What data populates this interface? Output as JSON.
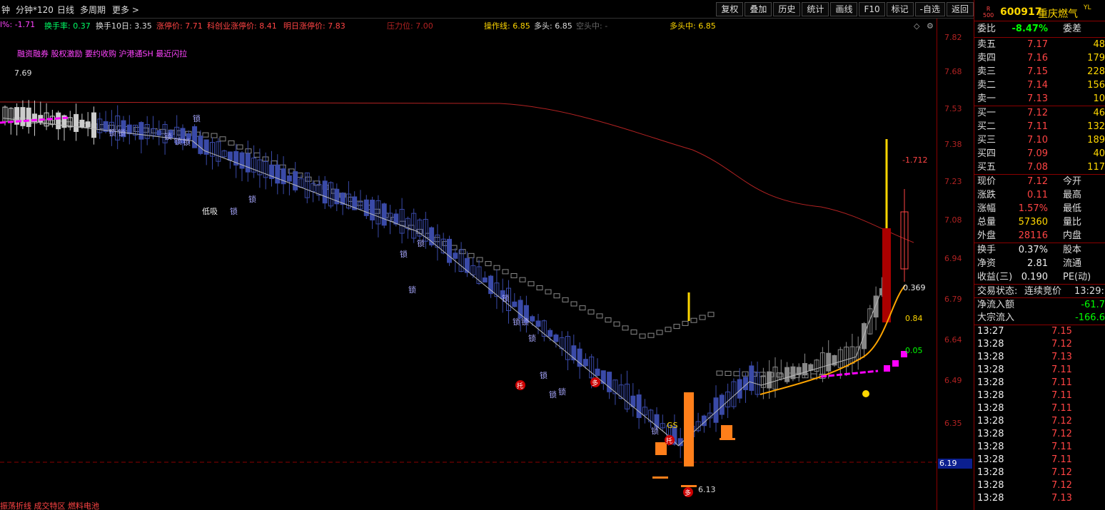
{
  "toolbar": {
    "left": [
      "钟",
      "分钟*120",
      "日线",
      "多周期",
      "更多 >"
    ],
    "right": [
      "复权",
      "叠加",
      "历史",
      "统计",
      "画线",
      "F10",
      "标记",
      "-自选",
      "返回"
    ]
  },
  "indicators": {
    "pct": "l%: -1.71",
    "turnover": "换手率: 0.37",
    "turnover10": "换手10日: 3.35",
    "limit_up": "涨停价: 7.71",
    "star_limit": "科创业涨停价: 8.41",
    "tomorrow_limit": "明日涨停价: 7.83",
    "pressure": "压力位: 7.00",
    "operate_line": "操作线: 6.85",
    "bull": "多头: 6.85",
    "bear": "空头中: -",
    "bull_mid": "多头中: 6.85"
  },
  "tags": "融资融券 股权激励 要约收购 沪港通SH 最近闪拉",
  "chart_labels": {
    "high_label": "7.69",
    "low_label": "6.13",
    "right_v1": "-1.712",
    "right_v2": "0.369",
    "right_v3": "0.84",
    "right_v4": "0.05",
    "low_absorb": "低吸",
    "gs": "GS",
    "lock": "锁",
    "tuo": "托",
    "duo": "多",
    "bottom_text": "振荡折线 成交特区 燃料电池"
  },
  "yaxis": [
    "7.82",
    "7.68",
    "7.53",
    "7.38",
    "7.23",
    "7.08",
    "6.94",
    "6.79",
    "6.64",
    "6.49",
    "6.35",
    "6.19"
  ],
  "current_price_tag": "6.19",
  "colors": {
    "up": "#ff4444",
    "down": "#3a4aa8",
    "orange": "#ff7f1a",
    "ma_white": "#bbbbbb",
    "ma_red": "#b22222",
    "magenta": "#ff00ff",
    "yellow": "#ffd700"
  },
  "quote": {
    "market": "R\n500",
    "code": "600917",
    "name": "重庆燃气",
    "badge": "YL",
    "weibi_label": "委比",
    "weibi": "-8.47%",
    "weicha_label": "委差",
    "asks": [
      {
        "label": "卖五",
        "price": "7.17",
        "vol": "48"
      },
      {
        "label": "卖四",
        "price": "7.16",
        "vol": "179"
      },
      {
        "label": "卖三",
        "price": "7.15",
        "vol": "228"
      },
      {
        "label": "卖二",
        "price": "7.14",
        "vol": "156"
      },
      {
        "label": "卖一",
        "price": "7.13",
        "vol": "10"
      }
    ],
    "bids": [
      {
        "label": "买一",
        "price": "7.12",
        "vol": "46"
      },
      {
        "label": "买二",
        "price": "7.11",
        "vol": "132"
      },
      {
        "label": "买三",
        "price": "7.10",
        "vol": "189"
      },
      {
        "label": "买四",
        "price": "7.09",
        "vol": "40"
      },
      {
        "label": "买五",
        "price": "7.08",
        "vol": "117"
      }
    ],
    "stats": [
      {
        "l": "现价",
        "v": "7.12",
        "cls": "red",
        "r": "今开"
      },
      {
        "l": "涨跌",
        "v": "0.11",
        "cls": "red",
        "r": "最高"
      },
      {
        "l": "涨幅",
        "v": "1.57%",
        "cls": "red",
        "r": "最低"
      },
      {
        "l": "总量",
        "v": "57360",
        "cls": "yellow",
        "r": "量比"
      },
      {
        "l": "外盘",
        "v": "28116",
        "cls": "red",
        "r": "内盘"
      }
    ],
    "stats2": [
      {
        "l": "换手",
        "v": "0.37%",
        "r": "股本"
      },
      {
        "l": "净资",
        "v": "2.81",
        "r": "流通"
      },
      {
        "l": "收益(三)",
        "v": "0.190",
        "r": "PE(动)"
      }
    ],
    "trade_status_label": "交易状态:",
    "trade_status": "连续竞价",
    "trade_time": "13:29:",
    "net_inflow_label": "净流入额",
    "net_inflow": "-61.7",
    "block_inflow_label": "大宗流入",
    "block_inflow": "-166.6",
    "ticks": [
      {
        "t": "13:27",
        "p": "7.15"
      },
      {
        "t": "13:28",
        "p": "7.12"
      },
      {
        "t": "13:28",
        "p": "7.13"
      },
      {
        "t": "13:28",
        "p": "7.11"
      },
      {
        "t": "13:28",
        "p": "7.11"
      },
      {
        "t": "13:28",
        "p": "7.11"
      },
      {
        "t": "13:28",
        "p": "7.11"
      },
      {
        "t": "13:28",
        "p": "7.12"
      },
      {
        "t": "13:28",
        "p": "7.12"
      },
      {
        "t": "13:28",
        "p": "7.11"
      },
      {
        "t": "13:28",
        "p": "7.11"
      },
      {
        "t": "13:28",
        "p": "7.12"
      },
      {
        "t": "13:28",
        "p": "7.12"
      },
      {
        "t": "13:28",
        "p": "7.13"
      }
    ]
  }
}
